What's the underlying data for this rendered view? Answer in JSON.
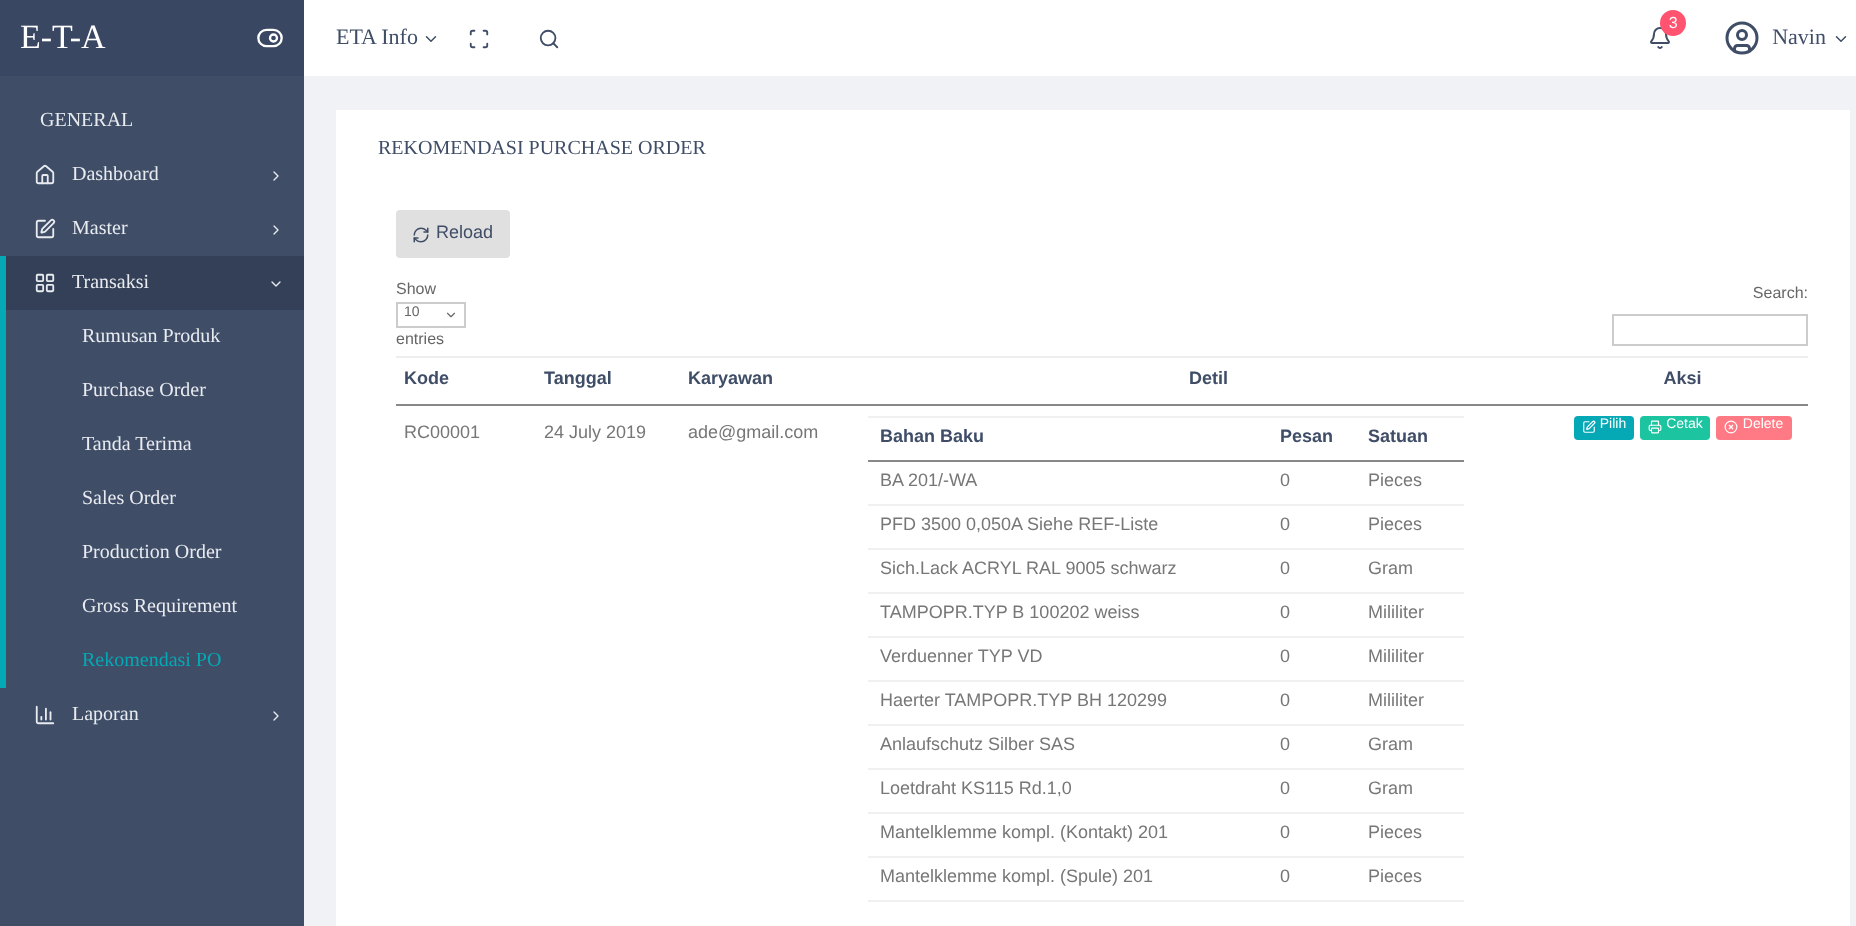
{
  "brand": "E-T-A",
  "sidebar": {
    "section": "GENERAL",
    "items": [
      {
        "label": "Dashboard",
        "expanded": false
      },
      {
        "label": "Master",
        "expanded": false
      },
      {
        "label": "Transaksi",
        "expanded": true,
        "children": [
          {
            "label": "Rumusan Produk",
            "selected": false
          },
          {
            "label": "Purchase Order",
            "selected": false
          },
          {
            "label": "Tanda Terima",
            "selected": false
          },
          {
            "label": "Sales Order",
            "selected": false
          },
          {
            "label": "Production Order",
            "selected": false
          },
          {
            "label": "Gross Requirement",
            "selected": false
          },
          {
            "label": "Rekomendasi PO",
            "selected": true
          }
        ]
      },
      {
        "label": "Laporan",
        "expanded": false
      }
    ]
  },
  "topbar": {
    "menu": "ETA Info",
    "notifications": "3",
    "user": "Navin"
  },
  "page": {
    "title": "REKOMENDASI PURCHASE ORDER",
    "reload": "Reload",
    "show_label": "Show",
    "page_size": "10",
    "entries_label": "entries",
    "search_label": "Search:"
  },
  "table": {
    "columns": [
      "Kode",
      "Tanggal",
      "Karyawan",
      "Detil",
      "Aksi"
    ],
    "rows": [
      {
        "kode": "RC00001",
        "tanggal": "24 July 2019",
        "karyawan": "ade@gmail.com",
        "detail_columns": [
          "Bahan Baku",
          "Pesan",
          "Satuan"
        ],
        "details": [
          [
            "BA 201/-WA",
            "0",
            "Pieces"
          ],
          [
            "PFD 3500 0,050A Siehe REF-Liste",
            "0",
            "Pieces"
          ],
          [
            "Sich.Lack ACRYL RAL 9005 schwarz",
            "0",
            "Gram"
          ],
          [
            "TAMPOPR.TYP B 100202 weiss",
            "0",
            "Mililiter"
          ],
          [
            "Verduenner TYP VD",
            "0",
            "Mililiter"
          ],
          [
            "Haerter TAMPOPR.TYP BH 120299",
            "0",
            "Mililiter"
          ],
          [
            "Anlaufschutz Silber SAS",
            "0",
            "Gram"
          ],
          [
            "Loetdraht KS115 Rd.1,0",
            "0",
            "Gram"
          ],
          [
            "Mantelklemme kompl. (Kontakt) 201",
            "0",
            "Pieces"
          ],
          [
            "Mantelklemme kompl. (Spule) 201",
            "0",
            "Pieces"
          ]
        ],
        "actions": [
          {
            "label": "Pilih",
            "kind": "edit"
          },
          {
            "label": "Cetak",
            "kind": "print"
          },
          {
            "label": "Delete",
            "kind": "delete"
          }
        ]
      }
    ]
  }
}
